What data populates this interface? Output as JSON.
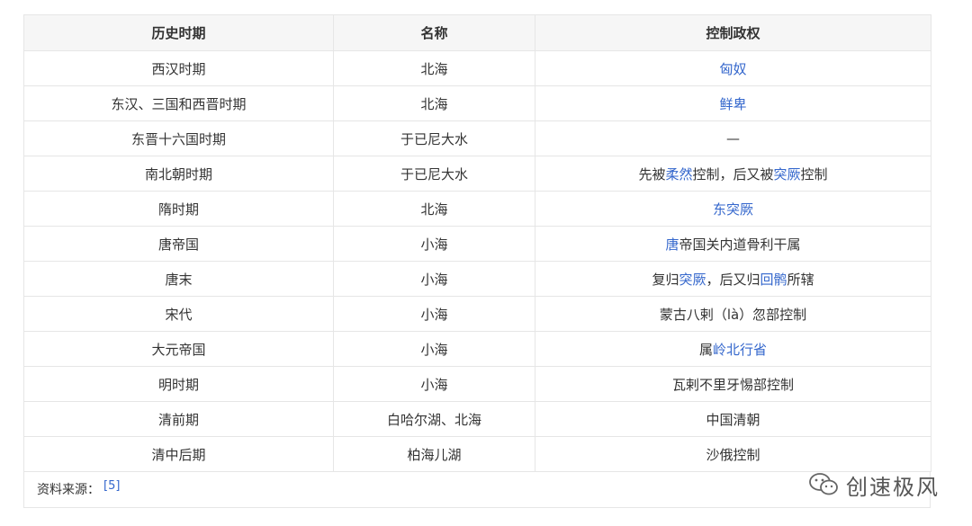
{
  "table": {
    "headers": [
      "历史时期",
      "名称",
      "控制政权"
    ],
    "rows": [
      {
        "period": "西汉时期",
        "name": "北海",
        "control": [
          {
            "t": "匈奴",
            "link": true
          }
        ]
      },
      {
        "period": "东汉、三国和西晋时期",
        "name": "北海",
        "control": [
          {
            "t": "鲜卑",
            "link": true
          }
        ]
      },
      {
        "period": "东晋十六国时期",
        "name": "于已尼大水",
        "control": [
          {
            "t": "—",
            "link": false
          }
        ]
      },
      {
        "period": "南北朝时期",
        "name": "于已尼大水",
        "control": [
          {
            "t": "先被",
            "link": false
          },
          {
            "t": "柔然",
            "link": true
          },
          {
            "t": "控制，后又被",
            "link": false
          },
          {
            "t": "突厥",
            "link": true
          },
          {
            "t": "控制",
            "link": false
          }
        ]
      },
      {
        "period": "隋时期",
        "name": "北海",
        "control": [
          {
            "t": "东突厥",
            "link": true
          }
        ]
      },
      {
        "period": "唐帝国",
        "name": "小海",
        "control": [
          {
            "t": "唐",
            "link": true
          },
          {
            "t": "帝国关内道骨利干属",
            "link": false
          }
        ]
      },
      {
        "period": "唐末",
        "name": "小海",
        "control": [
          {
            "t": "复归",
            "link": false
          },
          {
            "t": "突厥",
            "link": true
          },
          {
            "t": "，后又归",
            "link": false
          },
          {
            "t": "回鹘",
            "link": true
          },
          {
            "t": "所辖",
            "link": false
          }
        ]
      },
      {
        "period": "宋代",
        "name": "小海",
        "control": [
          {
            "t": "蒙古八剌（là）忽部控制",
            "link": false
          }
        ]
      },
      {
        "period": "大元帝国",
        "name": "小海",
        "control": [
          {
            "t": "属",
            "link": false
          },
          {
            "t": "岭北行省",
            "link": true
          }
        ]
      },
      {
        "period": "明时期",
        "name": "小海",
        "control": [
          {
            "t": "瓦剌不里牙惕部控制",
            "link": false
          }
        ]
      },
      {
        "period": "清前期",
        "name": "白哈尔湖、北海",
        "control": [
          {
            "t": "中国清朝",
            "link": false
          }
        ]
      },
      {
        "period": "清中后期",
        "name": "柏海儿湖",
        "control": [
          {
            "t": "沙俄控制",
            "link": false
          }
        ]
      }
    ]
  },
  "source": {
    "label": "资料来源：",
    "ref": "[5]"
  },
  "watermark": {
    "text": "创速极风",
    "icon": "wechat-icon"
  },
  "colors": {
    "link": "#3366cc",
    "header_bg": "#f6f6f6",
    "border": "#e6e6e6"
  }
}
